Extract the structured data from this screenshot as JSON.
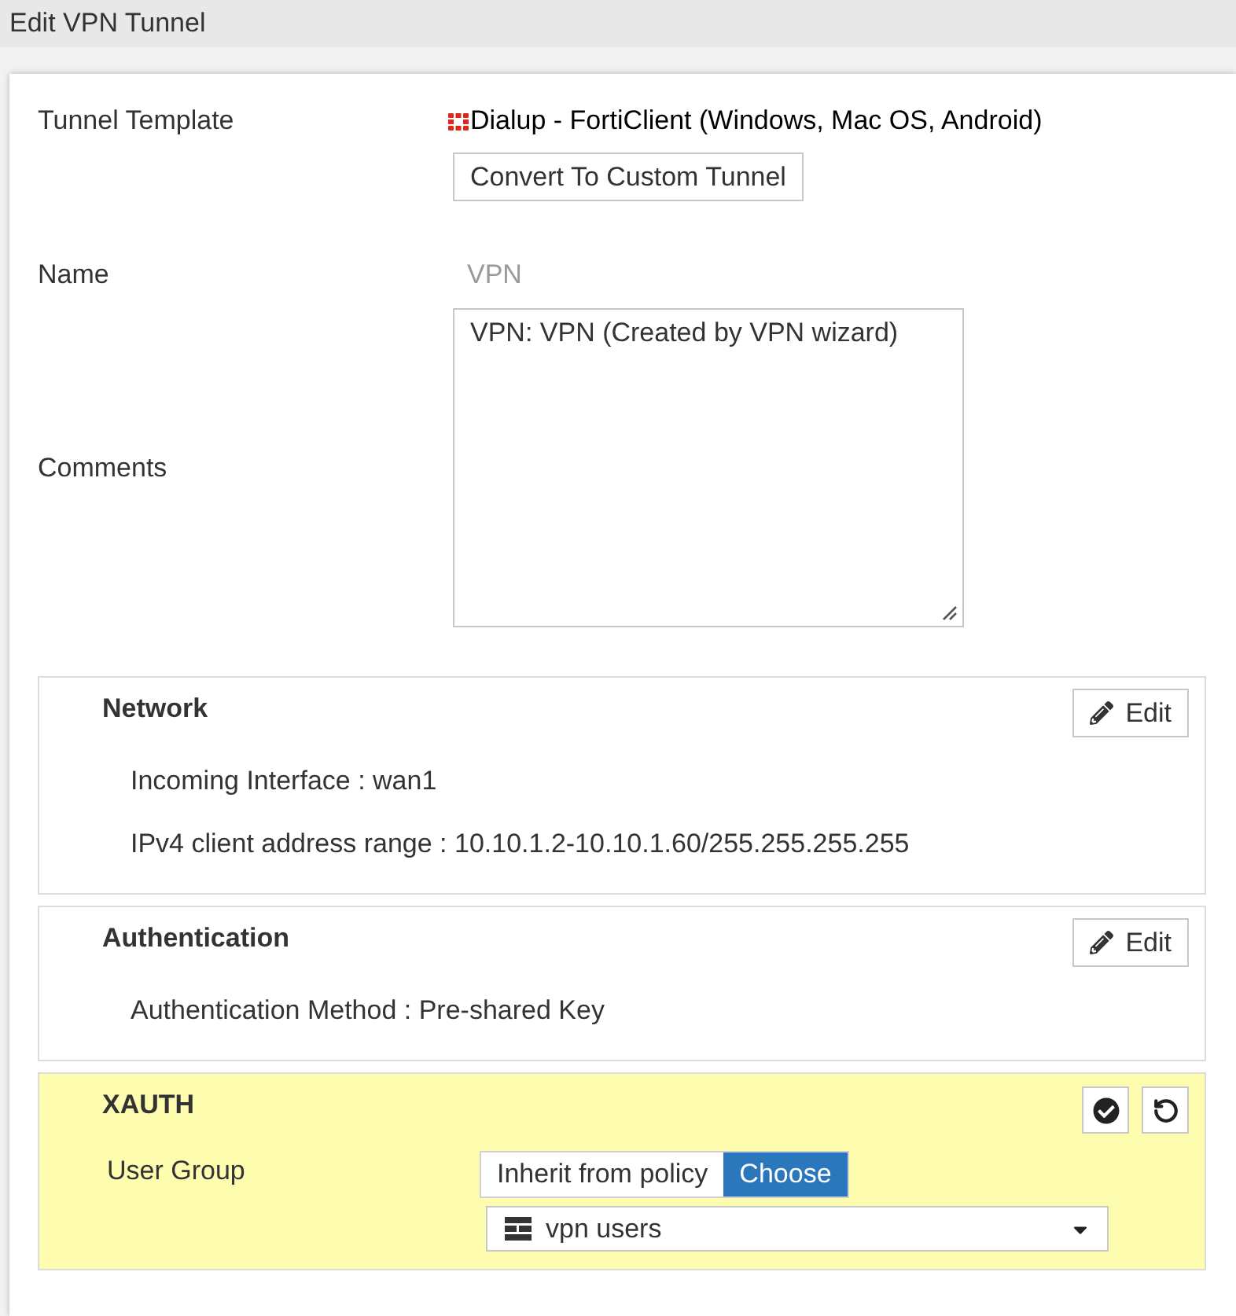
{
  "window": {
    "title": "Edit VPN Tunnel"
  },
  "form": {
    "fields": [
      {
        "kind": "template",
        "label": "Tunnel Template",
        "value": "Dialup - FortiClient (Windows, Mac OS, Android)",
        "button": "Convert To Custom Tunnel"
      },
      {
        "kind": "readonly",
        "label": "Name",
        "value": "VPN"
      },
      {
        "kind": "textarea",
        "label": "Comments",
        "value": "VPN: VPN (Created by VPN wizard)"
      }
    ]
  },
  "sections": [
    {
      "title": "Network",
      "editing": false,
      "edit_button": "Edit",
      "lines": [
        "Incoming Interface : wan1",
        "IPv4 client address range : 10.10.1.2-10.10.1.60/255.255.255.255"
      ]
    },
    {
      "title": "Authentication",
      "editing": false,
      "edit_button": "Edit",
      "lines": [
        "Authentication Method : Pre-shared Key"
      ]
    },
    {
      "title": "XAUTH",
      "editing": true,
      "field": {
        "label": "User Group",
        "options": [
          {
            "label": "Inherit from policy",
            "selected": false
          },
          {
            "label": "Choose",
            "selected": true
          }
        ],
        "select": {
          "value": "vpn users"
        }
      }
    }
  ]
}
